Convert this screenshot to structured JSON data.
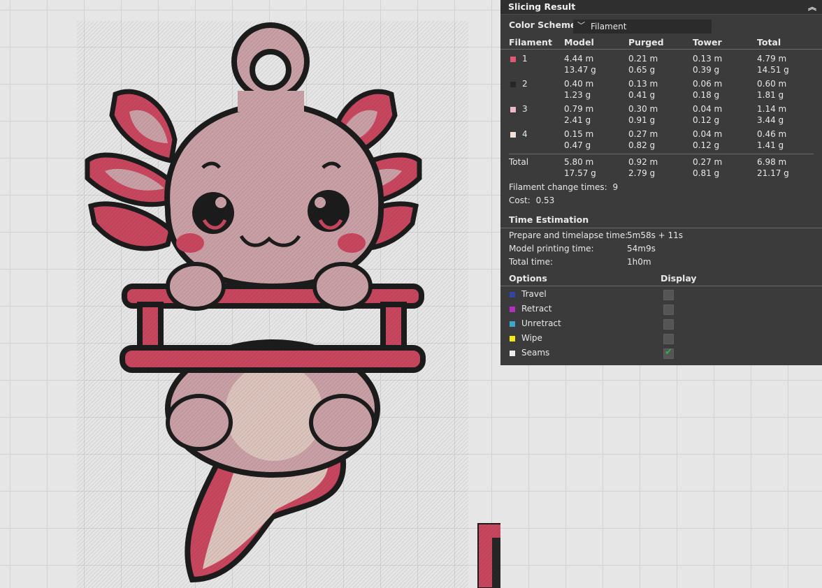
{
  "panel": {
    "title": "Slicing Result",
    "collapse_icon": "double-chevron-up-icon",
    "color_scheme": {
      "label": "Color Scheme",
      "selected": "Filament"
    },
    "table": {
      "headers": [
        "Filament",
        "Model",
        "Purged",
        "Tower",
        "Total"
      ],
      "rows": [
        {
          "id": "1",
          "color": "#e05a73",
          "model": [
            "4.44 m",
            "13.47 g"
          ],
          "purged": [
            "0.21 m",
            "0.65 g"
          ],
          "tower": [
            "0.13 m",
            "0.39 g"
          ],
          "total": [
            "4.79 m",
            "14.51 g"
          ]
        },
        {
          "id": "2",
          "color": "#262626",
          "model": [
            "0.40 m",
            "1.23 g"
          ],
          "purged": [
            "0.13 m",
            "0.41 g"
          ],
          "tower": [
            "0.06 m",
            "0.18 g"
          ],
          "total": [
            "0.60 m",
            "1.81 g"
          ]
        },
        {
          "id": "3",
          "color": "#f0b7c4",
          "model": [
            "0.79 m",
            "2.41 g"
          ],
          "purged": [
            "0.30 m",
            "0.91 g"
          ],
          "tower": [
            "0.04 m",
            "0.12 g"
          ],
          "total": [
            "1.14 m",
            "3.44 g"
          ]
        },
        {
          "id": "4",
          "color": "#f4ded6",
          "model": [
            "0.15 m",
            "0.47 g"
          ],
          "purged": [
            "0.27 m",
            "0.82 g"
          ],
          "tower": [
            "0.04 m",
            "0.12 g"
          ],
          "total": [
            "0.46 m",
            "1.41 g"
          ]
        }
      ],
      "total_row": {
        "label": "Total",
        "model": [
          "5.80 m",
          "17.57 g"
        ],
        "purged": [
          "0.92 m",
          "2.79 g"
        ],
        "tower": [
          "0.27 m",
          "0.81 g"
        ],
        "total": [
          "6.98 m",
          "21.17 g"
        ]
      }
    },
    "filament_change": {
      "label": "Filament change times:",
      "value": "9"
    },
    "cost": {
      "label": "Cost:",
      "value": "0.53"
    },
    "time_estimation": {
      "title": "Time Estimation",
      "rows": [
        {
          "label": "Prepare and timelapse time:",
          "value": "5m58s + 11s"
        },
        {
          "label": "Model printing time:",
          "value": "54m9s"
        },
        {
          "label": "Total time:",
          "value": "1h0m"
        }
      ]
    },
    "options": {
      "title": "Options",
      "display_label": "Display",
      "items": [
        {
          "label": "Travel",
          "color": "#3346a8",
          "checked": false
        },
        {
          "label": "Retract",
          "color": "#b52fc7",
          "checked": false
        },
        {
          "label": "Unretract",
          "color": "#3ba6cc",
          "checked": false
        },
        {
          "label": "Wipe",
          "color": "#f2ea12",
          "checked": false
        },
        {
          "label": "Seams",
          "color": "#eeeeee",
          "checked": true
        }
      ]
    }
  },
  "colors": {
    "outline": "#1c1c1c",
    "pink": "#c9a0a6",
    "red": "#c8475f",
    "light": "#dcc4bd",
    "bed": "#e6e6e6"
  }
}
